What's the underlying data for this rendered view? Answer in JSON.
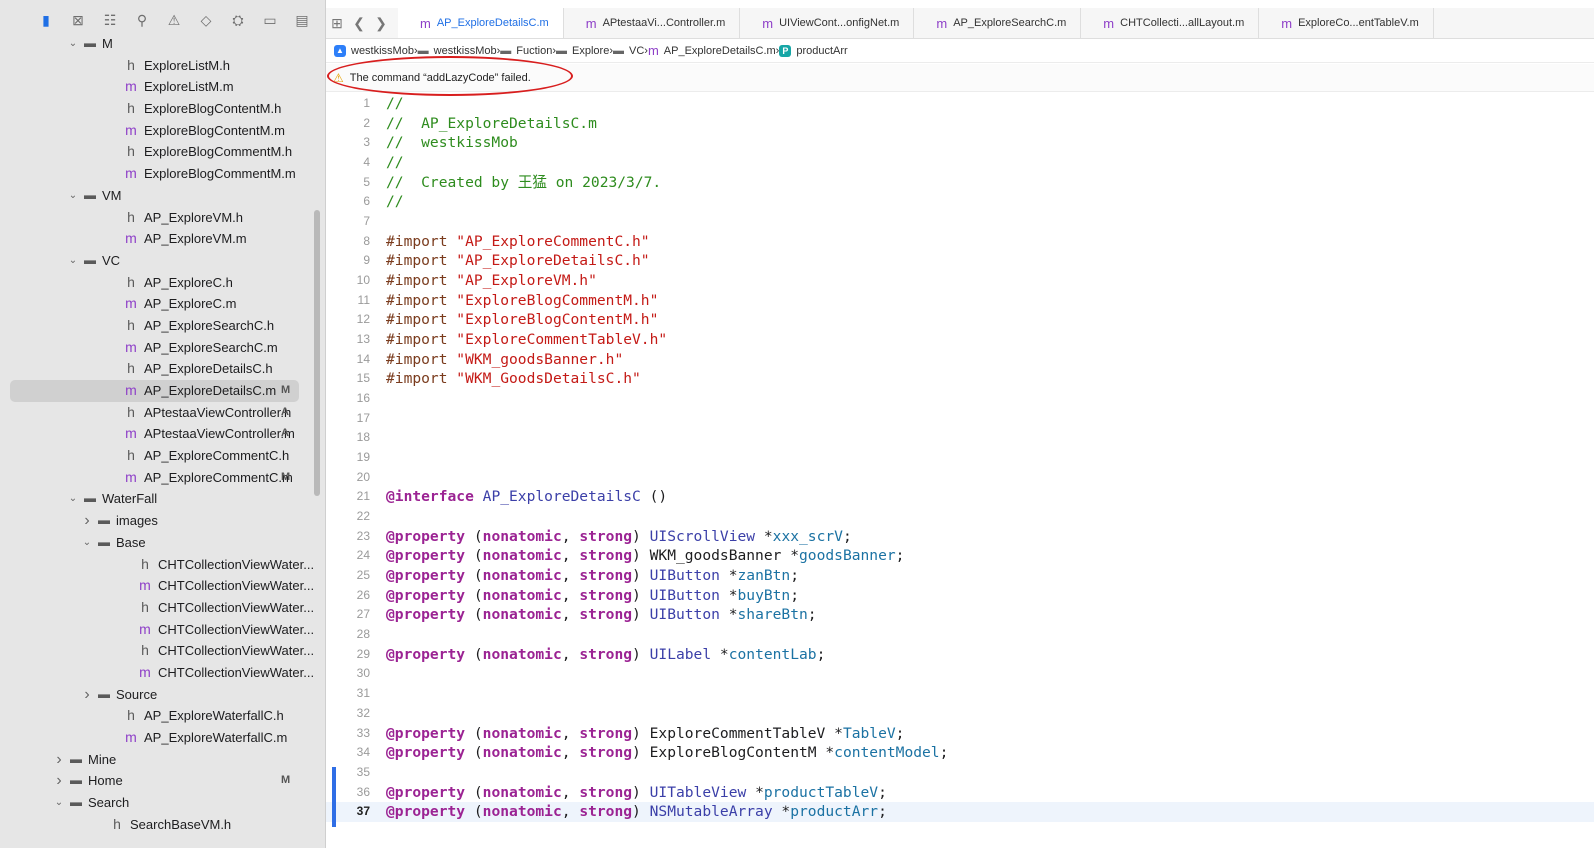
{
  "sidebar": {
    "tree": [
      {
        "name": "M",
        "kind": "folder",
        "indent": 1,
        "open": true
      },
      {
        "name": "ExploreListM.h",
        "kind": "h",
        "indent": 2
      },
      {
        "name": "ExploreListM.m",
        "kind": "m",
        "indent": 2
      },
      {
        "name": "ExploreBlogContentM.h",
        "kind": "h",
        "indent": 2
      },
      {
        "name": "ExploreBlogContentM.m",
        "kind": "m",
        "indent": 2
      },
      {
        "name": "ExploreBlogCommentM.h",
        "kind": "h",
        "indent": 2
      },
      {
        "name": "ExploreBlogCommentM.m",
        "kind": "m",
        "indent": 2
      },
      {
        "name": "VM",
        "kind": "folder",
        "indent": 1,
        "open": true
      },
      {
        "name": "AP_ExploreVM.h",
        "kind": "h",
        "indent": 2
      },
      {
        "name": "AP_ExploreVM.m",
        "kind": "m",
        "indent": 2
      },
      {
        "name": "VC",
        "kind": "folder",
        "indent": 1,
        "open": true
      },
      {
        "name": "AP_ExploreC.h",
        "kind": "h",
        "indent": 2
      },
      {
        "name": "AP_ExploreC.m",
        "kind": "m",
        "indent": 2
      },
      {
        "name": "AP_ExploreSearchC.h",
        "kind": "h",
        "indent": 2
      },
      {
        "name": "AP_ExploreSearchC.m",
        "kind": "m",
        "indent": 2
      },
      {
        "name": "AP_ExploreDetailsC.h",
        "kind": "h",
        "indent": 2
      },
      {
        "name": "AP_ExploreDetailsC.m",
        "kind": "m",
        "indent": 2,
        "badge": "M",
        "selected": true
      },
      {
        "name": "APtestaaViewController.h",
        "kind": "h",
        "indent": 2,
        "badge": "A"
      },
      {
        "name": "APtestaaViewController.m",
        "kind": "m",
        "indent": 2,
        "badge": "A"
      },
      {
        "name": "AP_ExploreCommentC.h",
        "kind": "h",
        "indent": 2
      },
      {
        "name": "AP_ExploreCommentC.m",
        "kind": "m",
        "indent": 2,
        "badge": "M"
      },
      {
        "name": "WaterFall",
        "kind": "folder",
        "indent": 1,
        "open": true
      },
      {
        "name": "images",
        "kind": "folder",
        "indent": 2,
        "open": false
      },
      {
        "name": "Base",
        "kind": "folder",
        "indent": 2,
        "open": true
      },
      {
        "name": "CHTCollectionViewWater...",
        "kind": "h",
        "indent": 3
      },
      {
        "name": "CHTCollectionViewWater...",
        "kind": "m",
        "indent": 3
      },
      {
        "name": "CHTCollectionViewWater...",
        "kind": "h",
        "indent": 3
      },
      {
        "name": "CHTCollectionViewWater...",
        "kind": "m",
        "indent": 3
      },
      {
        "name": "CHTCollectionViewWater...",
        "kind": "h",
        "indent": 3
      },
      {
        "name": "CHTCollectionViewWater...",
        "kind": "m",
        "indent": 3
      },
      {
        "name": "Source",
        "kind": "folder",
        "indent": 2,
        "open": false
      },
      {
        "name": "AP_ExploreWaterfallC.h",
        "kind": "h",
        "indent": 2
      },
      {
        "name": "AP_ExploreWaterfallC.m",
        "kind": "m",
        "indent": 2
      },
      {
        "name": "Mine",
        "kind": "folder",
        "indent": 0,
        "open": false
      },
      {
        "name": "Home",
        "kind": "folder",
        "indent": 0,
        "open": false,
        "badge": "M"
      },
      {
        "name": "Search",
        "kind": "folder",
        "indent": 0,
        "open": true
      },
      {
        "name": "SearchBaseVM.h",
        "kind": "h",
        "indent": 1
      }
    ]
  },
  "tabs": [
    {
      "label": "AP_ExploreDetailsC.m",
      "active": true
    },
    {
      "label": "APtestaaVi...Controller.m"
    },
    {
      "label": "UIViewCont...onfigNet.m"
    },
    {
      "label": "AP_ExploreSearchC.m"
    },
    {
      "label": "CHTCollecti...allLayout.m"
    },
    {
      "label": "ExploreCo...entTableV.m"
    }
  ],
  "breadcrumb": [
    {
      "label": "westkissMob",
      "icon": "app"
    },
    {
      "label": "westkissMob",
      "icon": "folder"
    },
    {
      "label": "Fuction",
      "icon": "folder"
    },
    {
      "label": "Explore",
      "icon": "folder"
    },
    {
      "label": "VC",
      "icon": "folder"
    },
    {
      "label": "AP_ExploreDetailsC.m",
      "icon": "m"
    },
    {
      "label": "productArr",
      "icon": "p"
    }
  ],
  "issue": {
    "message": "The command “addLazyCode” failed."
  },
  "code": {
    "current_line": 37,
    "lines": [
      [
        [
          "//",
          "c-comment"
        ]
      ],
      [
        [
          "//  AP_ExploreDetailsC.m",
          "c-comment"
        ]
      ],
      [
        [
          "//  westkissMob",
          "c-comment"
        ]
      ],
      [
        [
          "//",
          "c-comment"
        ]
      ],
      [
        [
          "//  Created by 王猛 on 2023/3/7.",
          "c-comment"
        ]
      ],
      [
        [
          "//",
          "c-comment"
        ]
      ],
      [],
      [
        [
          "#import ",
          "c-pre"
        ],
        [
          "\"AP_ExploreCommentC.h\"",
          "c-str"
        ]
      ],
      [
        [
          "#import ",
          "c-pre"
        ],
        [
          "\"AP_ExploreDetailsC.h\"",
          "c-str"
        ]
      ],
      [
        [
          "#import ",
          "c-pre"
        ],
        [
          "\"AP_ExploreVM.h\"",
          "c-str"
        ]
      ],
      [
        [
          "#import ",
          "c-pre"
        ],
        [
          "\"ExploreBlogCommentM.h\"",
          "c-str"
        ]
      ],
      [
        [
          "#import ",
          "c-pre"
        ],
        [
          "\"ExploreBlogContentM.h\"",
          "c-str"
        ]
      ],
      [
        [
          "#import ",
          "c-pre"
        ],
        [
          "\"ExploreCommentTableV.h\"",
          "c-str"
        ]
      ],
      [
        [
          "#import ",
          "c-pre"
        ],
        [
          "\"WKM_goodsBanner.h\"",
          "c-str"
        ]
      ],
      [
        [
          "#import ",
          "c-pre"
        ],
        [
          "\"WKM_GoodsDetailsC.h\"",
          "c-str"
        ]
      ],
      [],
      [],
      [],
      [],
      [],
      [
        [
          "@interface ",
          "c-kw"
        ],
        [
          "AP_ExploreDetailsC",
          "c-type"
        ],
        [
          " ()",
          "c-plain"
        ]
      ],
      [],
      [
        [
          "@property ",
          "c-kw"
        ],
        [
          "(",
          "c-plain"
        ],
        [
          "nonatomic",
          "c-kw"
        ],
        [
          ", ",
          "c-plain"
        ],
        [
          "strong",
          "c-kw"
        ],
        [
          ") ",
          "c-plain"
        ],
        [
          "UIScrollView ",
          "c-type"
        ],
        [
          "*",
          "c-plain"
        ],
        [
          "xxx_scrV",
          "c-ivar"
        ],
        [
          ";",
          "c-plain"
        ]
      ],
      [
        [
          "@property ",
          "c-kw"
        ],
        [
          "(",
          "c-plain"
        ],
        [
          "nonatomic",
          "c-kw"
        ],
        [
          ", ",
          "c-plain"
        ],
        [
          "strong",
          "c-kw"
        ],
        [
          ") ",
          "c-plain"
        ],
        [
          "WKM_goodsBanner ",
          "c-plain"
        ],
        [
          "*",
          "c-plain"
        ],
        [
          "goodsBanner",
          "c-ivar"
        ],
        [
          ";",
          "c-plain"
        ]
      ],
      [
        [
          "@property ",
          "c-kw"
        ],
        [
          "(",
          "c-plain"
        ],
        [
          "nonatomic",
          "c-kw"
        ],
        [
          ", ",
          "c-plain"
        ],
        [
          "strong",
          "c-kw"
        ],
        [
          ") ",
          "c-plain"
        ],
        [
          "UIButton ",
          "c-type"
        ],
        [
          "*",
          "c-plain"
        ],
        [
          "zanBtn",
          "c-ivar"
        ],
        [
          ";",
          "c-plain"
        ]
      ],
      [
        [
          "@property ",
          "c-kw"
        ],
        [
          "(",
          "c-plain"
        ],
        [
          "nonatomic",
          "c-kw"
        ],
        [
          ", ",
          "c-plain"
        ],
        [
          "strong",
          "c-kw"
        ],
        [
          ") ",
          "c-plain"
        ],
        [
          "UIButton ",
          "c-type"
        ],
        [
          "*",
          "c-plain"
        ],
        [
          "buyBtn",
          "c-ivar"
        ],
        [
          ";",
          "c-plain"
        ]
      ],
      [
        [
          "@property ",
          "c-kw"
        ],
        [
          "(",
          "c-plain"
        ],
        [
          "nonatomic",
          "c-kw"
        ],
        [
          ", ",
          "c-plain"
        ],
        [
          "strong",
          "c-kw"
        ],
        [
          ") ",
          "c-plain"
        ],
        [
          "UIButton ",
          "c-type"
        ],
        [
          "*",
          "c-plain"
        ],
        [
          "shareBtn",
          "c-ivar"
        ],
        [
          ";",
          "c-plain"
        ]
      ],
      [],
      [
        [
          "@property ",
          "c-kw"
        ],
        [
          "(",
          "c-plain"
        ],
        [
          "nonatomic",
          "c-kw"
        ],
        [
          ", ",
          "c-plain"
        ],
        [
          "strong",
          "c-kw"
        ],
        [
          ") ",
          "c-plain"
        ],
        [
          "UILabel ",
          "c-type"
        ],
        [
          "*",
          "c-plain"
        ],
        [
          "contentLab",
          "c-ivar"
        ],
        [
          ";",
          "c-plain"
        ]
      ],
      [],
      [],
      [],
      [
        [
          "@property ",
          "c-kw"
        ],
        [
          "(",
          "c-plain"
        ],
        [
          "nonatomic",
          "c-kw"
        ],
        [
          ", ",
          "c-plain"
        ],
        [
          "strong",
          "c-kw"
        ],
        [
          ") ",
          "c-plain"
        ],
        [
          "ExploreCommentTableV ",
          "c-plain"
        ],
        [
          "*",
          "c-plain"
        ],
        [
          "TableV",
          "c-ivar"
        ],
        [
          ";",
          "c-plain"
        ]
      ],
      [
        [
          "@property ",
          "c-kw"
        ],
        [
          "(",
          "c-plain"
        ],
        [
          "nonatomic",
          "c-kw"
        ],
        [
          ", ",
          "c-plain"
        ],
        [
          "strong",
          "c-kw"
        ],
        [
          ") ",
          "c-plain"
        ],
        [
          "ExploreBlogContentM ",
          "c-plain"
        ],
        [
          "*",
          "c-plain"
        ],
        [
          "contentModel",
          "c-ivar"
        ],
        [
          ";",
          "c-plain"
        ]
      ],
      [],
      [
        [
          "@property ",
          "c-kw"
        ],
        [
          "(",
          "c-plain"
        ],
        [
          "nonatomic",
          "c-kw"
        ],
        [
          ", ",
          "c-plain"
        ],
        [
          "strong",
          "c-kw"
        ],
        [
          ") ",
          "c-plain"
        ],
        [
          "UITableView ",
          "c-type"
        ],
        [
          "*",
          "c-plain"
        ],
        [
          "productTableV",
          "c-ivar"
        ],
        [
          ";",
          "c-plain"
        ]
      ],
      [
        [
          "@property ",
          "c-kw"
        ],
        [
          "(",
          "c-plain"
        ],
        [
          "nonatomic",
          "c-kw"
        ],
        [
          ", ",
          "c-plain"
        ],
        [
          "strong",
          "c-kw"
        ],
        [
          ") ",
          "c-plain"
        ],
        [
          "NSMutableArray ",
          "c-type"
        ],
        [
          "*",
          "c-plain"
        ],
        [
          "productArr",
          "c-ivar"
        ],
        [
          ";",
          "c-plain"
        ]
      ]
    ]
  }
}
